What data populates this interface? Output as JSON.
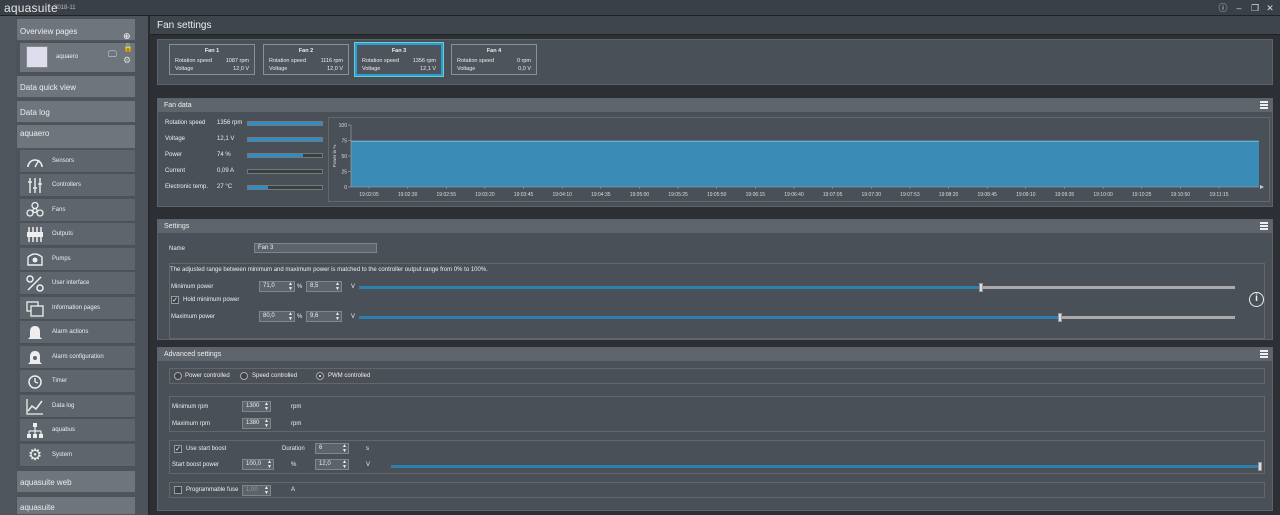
{
  "app": {
    "name": "aquasuite",
    "version": "2018-11",
    "window_buttons": [
      "info-icon",
      "minimize-icon",
      "restore-icon",
      "close-icon"
    ]
  },
  "sidebar": {
    "overview": "Overview pages",
    "overview_item": "aquaero",
    "data_quick_view": "Data quick view",
    "data_log": "Data log",
    "device": "aquaero",
    "items": [
      "Sensors",
      "Controllers",
      "Fans",
      "Outputs",
      "Pumps",
      "User interface",
      "Information pages",
      "Alarm actions",
      "Alarm configuration",
      "Timer",
      "Data log",
      "aquabus",
      "System"
    ],
    "aquasuite_web": "aquasuite web",
    "aquasuite": "aquasuite"
  },
  "page": {
    "title": "Fan settings"
  },
  "fans": [
    {
      "name": "Fan 1",
      "rot_label": "Rotation speed",
      "rot": "1087 rpm",
      "volt_label": "Voltage",
      "volt": "12,0 V"
    },
    {
      "name": "Fan 2",
      "rot_label": "Rotation speed",
      "rot": "1116 rpm",
      "volt_label": "Voltage",
      "volt": "12,0 V"
    },
    {
      "name": "Fan 3",
      "rot_label": "Rotation speed",
      "rot": "1356 rpm",
      "volt_label": "Voltage",
      "volt": "12,1 V"
    },
    {
      "name": "Fan 4",
      "rot_label": "Rotation speed",
      "rot": "0 rpm",
      "volt_label": "Voltage",
      "volt": "0,0 V"
    }
  ],
  "fan_data": {
    "title": "Fan data",
    "rows": [
      {
        "label": "Rotation speed",
        "value": "1356 rpm",
        "fill": 1.0
      },
      {
        "label": "Voltage",
        "value": "12,1 V",
        "fill": 1.0
      },
      {
        "label": "Power",
        "value": "74 %",
        "fill": 0.74
      },
      {
        "label": "Current",
        "value": "0,09 A",
        "fill": 0.0
      },
      {
        "label": "Electronic temp.",
        "value": "27 °C",
        "fill": 0.27
      }
    ]
  },
  "chart_data": {
    "type": "area",
    "ylabel": "Power in %",
    "ylim": [
      0,
      100
    ],
    "yticks": [
      "100",
      "75",
      "50",
      "25",
      "0"
    ],
    "x": [
      "19:02:05",
      "19:02:30",
      "19:02:55",
      "19:03:20",
      "19:03:45",
      "19:04:10",
      "19:04:35",
      "19:05:00",
      "19:05:25",
      "19:05:50",
      "19:06:15",
      "19:06:40",
      "19:07:05",
      "19:07:30",
      "19:07:53",
      "19:08:20",
      "19:08:45",
      "19:09:10",
      "19:09:35",
      "19:10:00",
      "19:10:25",
      "19:10:50",
      "19:11:15"
    ],
    "values": [
      74,
      74,
      74,
      74,
      74,
      74,
      74,
      74,
      74,
      74,
      74,
      74,
      74,
      74,
      74,
      74,
      74,
      74,
      74,
      74,
      74,
      74,
      74
    ],
    "colors": {
      "fill": "#3a8bb5",
      "line": "#8fd3f2"
    }
  },
  "settings": {
    "title": "Settings",
    "name_label": "Name",
    "name_value": "Fan 3",
    "info_text": "The adjusted range between minimum and maximum power is matched to the controller output range from 0% to 100%.",
    "min_label": "Minimum power",
    "min_pct": "71,0",
    "min_volt": "8,5",
    "min_frac": 0.71,
    "hold_label": "Hold minimum power",
    "max_label": "Maximum power",
    "max_pct": "80,0",
    "max_volt": "9,6",
    "max_frac": 0.8,
    "pct_unit": "%",
    "volt_unit": "V"
  },
  "advanced": {
    "title": "Advanced settings",
    "modes": [
      "Power controlled",
      "Speed controlled",
      "PWM controlled"
    ],
    "selected_mode": "PWM controlled",
    "min_rpm_label": "Minimum rpm",
    "min_rpm": "1300",
    "max_rpm_label": "Maximum rpm",
    "max_rpm": "1380",
    "rpm_unit": "rpm",
    "start_boost_label": "Use start boost",
    "duration_label": "Duration",
    "duration": "6",
    "duration_unit": "s",
    "boost_power_label": "Start boost power",
    "boost_pct": "100,0",
    "boost_volt": "12,0",
    "boost_frac": 1.0,
    "pct_unit": "%",
    "volt_unit": "V",
    "fuse_label": "Programmable fuse",
    "fuse_value": "1,00",
    "fuse_unit": "A"
  }
}
